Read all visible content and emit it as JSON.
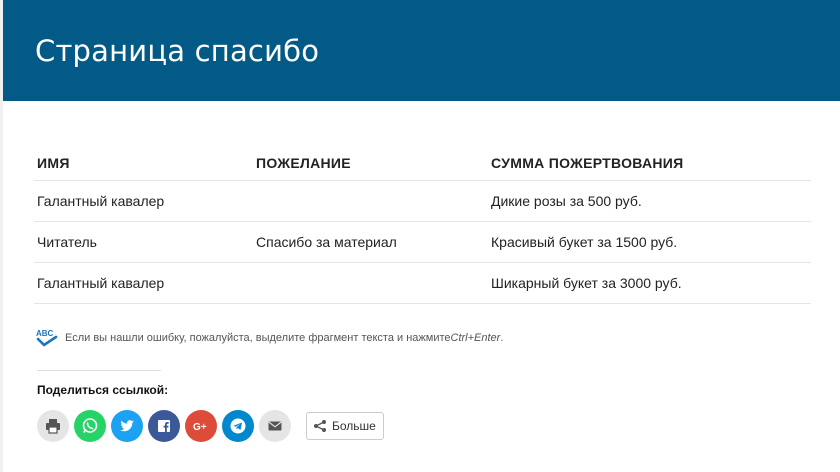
{
  "header": {
    "title": "Страница спасибо"
  },
  "table": {
    "columns": [
      "Имя",
      "Пожелание",
      "Сумма пожертвования"
    ],
    "rows": [
      [
        "Галантный кавалер",
        "",
        "Дикие розы за 500 руб."
      ],
      [
        "Читатель",
        "Спасибо за материал",
        "Красивый букет за 1500 руб."
      ],
      [
        "Галантный кавалер",
        "",
        "Шикарный букет за 3000 руб."
      ]
    ]
  },
  "notice": {
    "text": "Если вы нашли ошибку, пожалуйста, выделите фрагмент текста и нажмите ",
    "hotkey": "Ctrl+Enter",
    "end": ".",
    "icon_label": "ABC"
  },
  "share": {
    "title": "Поделиться ссылкой:",
    "buttons": [
      {
        "name": "print",
        "icon": "printer-icon",
        "color": "#e5e5e5"
      },
      {
        "name": "whatsapp",
        "icon": "whatsapp-icon",
        "color": "#25d366"
      },
      {
        "name": "twitter",
        "icon": "twitter-icon",
        "color": "#1da1f2"
      },
      {
        "name": "facebook",
        "icon": "facebook-icon",
        "color": "#3b5998"
      },
      {
        "name": "google-plus",
        "icon": "google-plus-icon",
        "color": "#dd4b39"
      },
      {
        "name": "telegram",
        "icon": "telegram-icon",
        "color": "#0088cc"
      },
      {
        "name": "email",
        "icon": "envelope-icon",
        "color": "#e5e5e5"
      }
    ],
    "more_label": "Больше"
  },
  "colors": {
    "header_bg": "#035a87",
    "header_text": "#ffffff"
  }
}
